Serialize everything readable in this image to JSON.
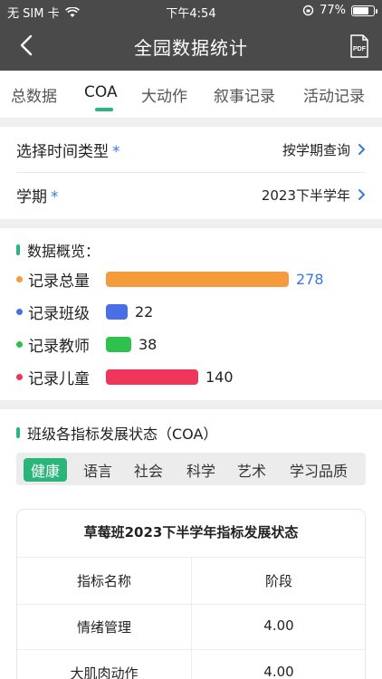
{
  "status_bar": {
    "carrier": "无 SIM 卡",
    "time": "下午4:54",
    "battery_percent": "77%",
    "battery_level": 0.77
  },
  "header": {
    "title": "全园数据统计",
    "pdf_label": "PDF"
  },
  "tabs": [
    {
      "label": "总数据",
      "active": false
    },
    {
      "label": "COA",
      "active": true
    },
    {
      "label": "大动作",
      "active": false
    },
    {
      "label": "叙事记录",
      "active": false
    },
    {
      "label": "活动记录",
      "active": false
    }
  ],
  "filters": {
    "time_type": {
      "label": "选择时间类型",
      "required_mark": "*",
      "value": "按学期查询"
    },
    "semester": {
      "label": "学期",
      "required_mark": "*",
      "value": "2023下半学年"
    }
  },
  "overview": {
    "title": "数据概览：",
    "items": [
      {
        "label": "记录总量",
        "value": 278,
        "color": "#f49c3c",
        "value_color": "#3a76e6"
      },
      {
        "label": "记录班级",
        "value": 22,
        "color": "#4a6ee6",
        "value_color": "#222222"
      },
      {
        "label": "记录教师",
        "value": 38,
        "color": "#2ec14d",
        "value_color": "#222222"
      },
      {
        "label": "记录儿童",
        "value": 140,
        "color": "#f0345a",
        "value_color": "#222222"
      }
    ]
  },
  "coa_section": {
    "title": "班级各指标发展状态（COA）",
    "categories": [
      {
        "label": "健康",
        "active": true
      },
      {
        "label": "语言",
        "active": false
      },
      {
        "label": "社会",
        "active": false
      },
      {
        "label": "科学",
        "active": false
      },
      {
        "label": "艺术",
        "active": false
      },
      {
        "label": "学习品质",
        "active": false
      }
    ],
    "table": {
      "caption": "草莓班2023下半学年指标发展状态",
      "headers": [
        "指标名称",
        "阶段"
      ],
      "rows": [
        [
          "情绪管理",
          "4.00"
        ],
        [
          "大肌肉动作",
          "4.00"
        ]
      ]
    }
  },
  "colors": {
    "accent": "#2bb57a",
    "link": "#3a76e6",
    "header_bg": "#4a4a4a"
  }
}
